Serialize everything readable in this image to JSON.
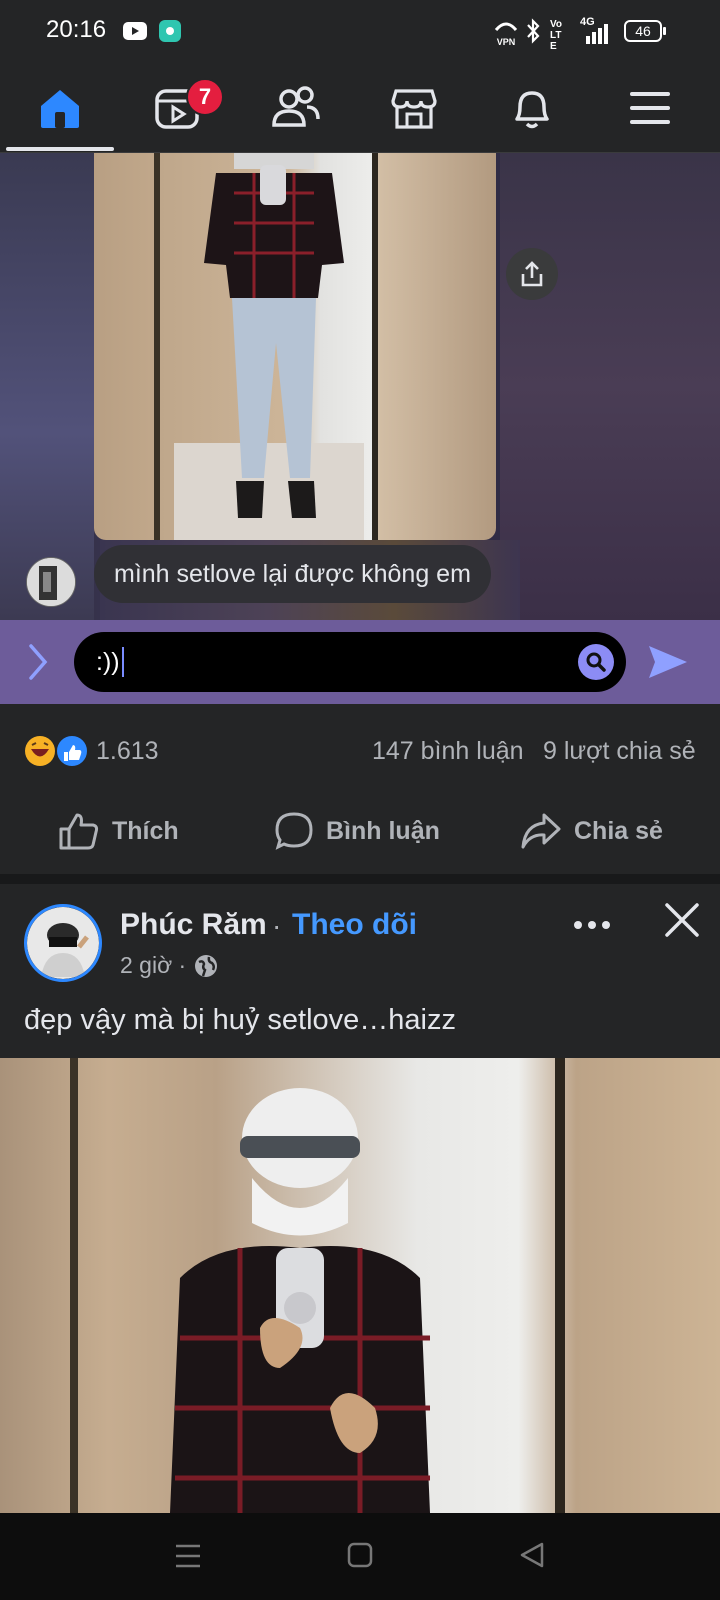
{
  "status_bar": {
    "time": "20:16",
    "icons": [
      "youtube-icon",
      "app-icon",
      "vpn-icon",
      "bluetooth-icon",
      "volte-icon",
      "4g-signal-icon",
      "battery-icon"
    ],
    "vpn_label": "VPN",
    "volte_label": "Vo LTE",
    "network_label": "4G",
    "battery_level": "46"
  },
  "nav": {
    "tabs": [
      "home",
      "watch",
      "friends",
      "marketplace",
      "notifications",
      "menu"
    ],
    "active": "home",
    "watch_badge": "7",
    "accent": "#2d88ff"
  },
  "shared_story": {
    "message": "mình setlove lại được không em"
  },
  "reply": {
    "value": ":))"
  },
  "stats": {
    "reactions_count": "1.613",
    "comments": "147 bình luận",
    "shares": "9 lượt chia sẻ"
  },
  "actions": {
    "like": "Thích",
    "comment": "Bình luận",
    "share": "Chia sẻ"
  },
  "post": {
    "author": "Phúc Răm",
    "separator": "·",
    "follow": "Theo dõi",
    "time": "2 giờ ·",
    "text": "đẹp vậy mà bị huỷ setlove…haizz"
  }
}
